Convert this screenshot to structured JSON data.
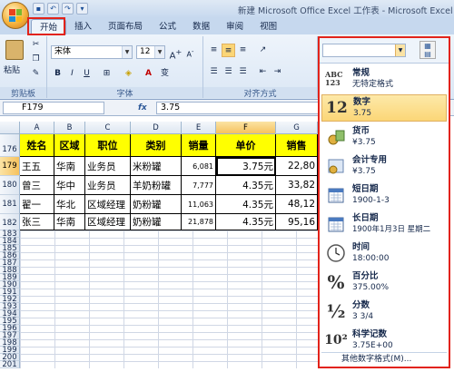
{
  "window": {
    "title": "新建 Microsoft Office Excel 工作表 - Microsoft Excel"
  },
  "tabs": [
    "开始",
    "插入",
    "页面布局",
    "公式",
    "数据",
    "审阅",
    "视图"
  ],
  "ribbon": {
    "font_name": "宋体",
    "font_size": "12",
    "groups": {
      "clipboard": "剪贴板",
      "font": "字体",
      "alignment": "对齐方式"
    },
    "paste_label": "粘贴"
  },
  "formula_bar": {
    "name_box": "F179",
    "fx": "fx",
    "value": "3.75"
  },
  "columns": [
    "A",
    "B",
    "C",
    "D",
    "E",
    "F",
    "G"
  ],
  "rows": [
    "176",
    "179",
    "180",
    "181",
    "182",
    "183",
    "184",
    "185",
    "186",
    "187",
    "188",
    "189",
    "190",
    "191",
    "192",
    "193",
    "194",
    "195",
    "196",
    "197",
    "198",
    "199",
    "200",
    "201"
  ],
  "table": {
    "headers": [
      "姓名",
      "区域",
      "职位",
      "类别",
      "销量",
      "单价",
      "销售"
    ],
    "data": [
      [
        "王五",
        "华南",
        "业务员",
        "米粉罐",
        "6,081",
        "3.75元",
        "22,80"
      ],
      [
        "曾三",
        "华中",
        "业务员",
        "羊奶粉罐",
        "7,777",
        "4.35元",
        "33,82"
      ],
      [
        "翟一",
        "华北",
        "区域经理",
        "奶粉罐",
        "11,063",
        "4.35元",
        "48,12"
      ],
      [
        "张三",
        "华南",
        "区域经理",
        "奶粉罐",
        "21,878",
        "4.35元",
        "95,16"
      ]
    ]
  },
  "number_format": {
    "items": [
      {
        "icon": "ABC 123",
        "name": "常规",
        "sample": "无特定格式"
      },
      {
        "icon": "12",
        "name": "数字",
        "sample": "3.75"
      },
      {
        "icon": "currency-icon",
        "name": "货币",
        "sample": "¥3.75"
      },
      {
        "icon": "accounting-icon",
        "name": "会计专用",
        "sample": "¥3.75"
      },
      {
        "icon": "calendar-icon",
        "name": "短日期",
        "sample": "1900-1-3"
      },
      {
        "icon": "calendar-icon",
        "name": "长日期",
        "sample": "1900年1月3日 星期二"
      },
      {
        "icon": "clock-icon",
        "name": "时间",
        "sample": "18:00:00"
      },
      {
        "icon": "%",
        "name": "百分比",
        "sample": "375.00%"
      },
      {
        "icon": "½",
        "name": "分数",
        "sample": "3 3/4"
      },
      {
        "icon": "10²",
        "name": "科学记数",
        "sample": "3.75E+00"
      }
    ],
    "selected_index": 1,
    "more": "其他数字格式(M)..."
  },
  "colors": {
    "accent_red": "#e2231a",
    "highlight": "#ffff00",
    "selected": "#fbd677"
  }
}
